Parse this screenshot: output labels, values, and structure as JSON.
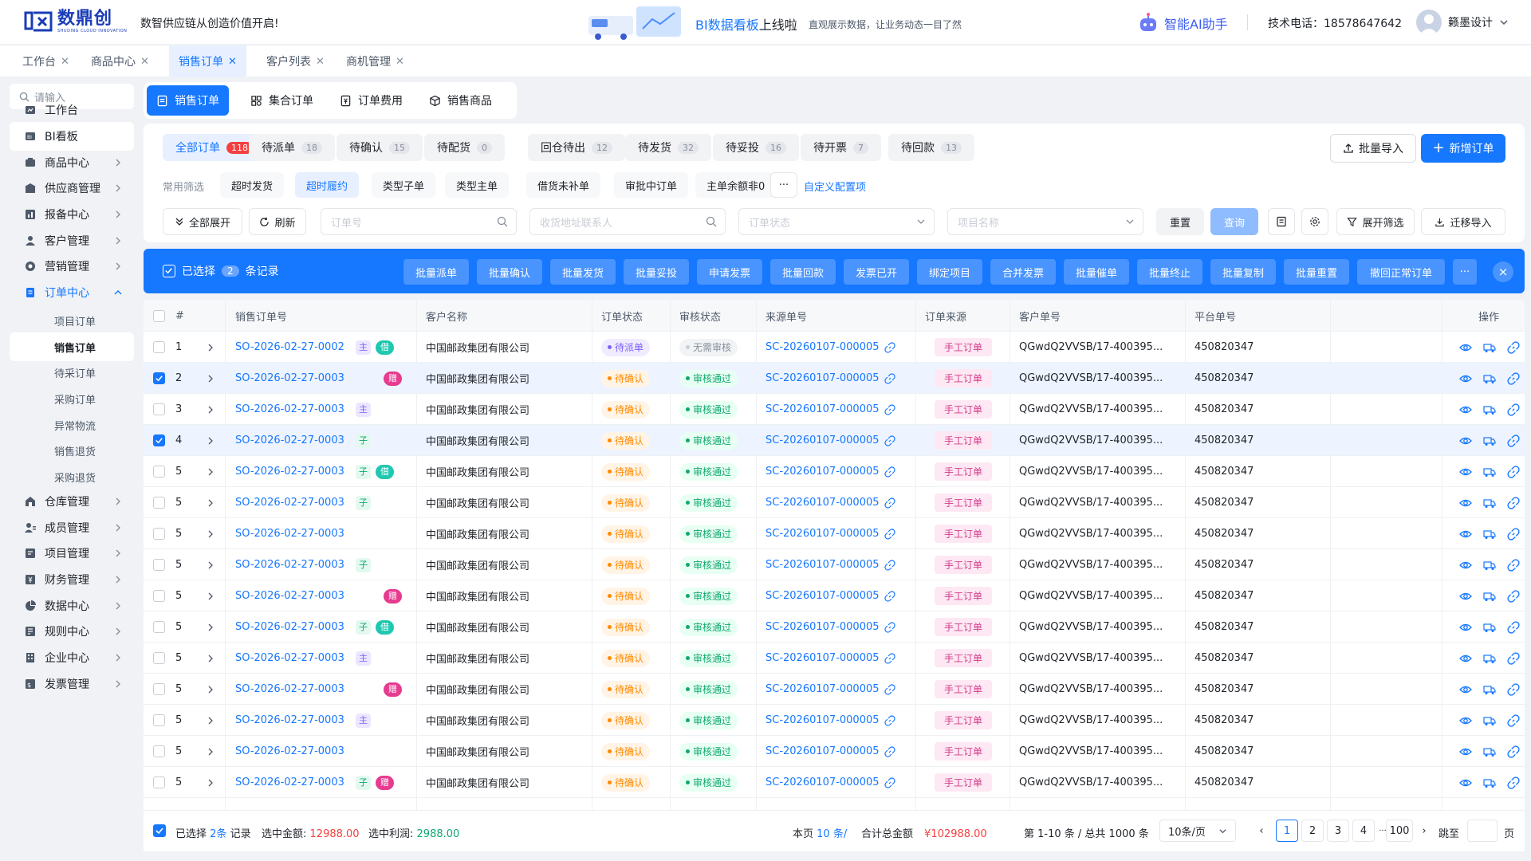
{
  "header": {
    "logo_text": "数鼎创",
    "logo_sub": "SHUDING CLOUD INNOVATION",
    "slogan": "数智供应链从创造价值开启!",
    "banner_title_a": "BI数据看板",
    "banner_title_b": "上线啦",
    "banner_desc": "直观展示数据，让业务动态一目了然",
    "ai_assistant": "智能AI助手",
    "phone": "技术电话：18578647642",
    "user_name": "籁墨设计"
  },
  "tabs": [
    {
      "label": "工作台"
    },
    {
      "label": "商品中心"
    },
    {
      "label": "销售订单"
    },
    {
      "label": "客户列表"
    },
    {
      "label": "商机管理"
    }
  ],
  "sidebar": {
    "search_placeholder": "请输入",
    "items": [
      {
        "label": "工作台",
        "icon": "workbench-icon"
      },
      {
        "label": "BI看板",
        "icon": "bi-board-icon"
      },
      {
        "label": "商品中心",
        "icon": "goods-icon"
      },
      {
        "label": "供应商管理",
        "icon": "supplier-icon"
      },
      {
        "label": "报备中心",
        "icon": "report-icon"
      },
      {
        "label": "客户管理",
        "icon": "customer-icon"
      },
      {
        "label": "营销管理",
        "icon": "marketing-icon"
      },
      {
        "label": "订单中心",
        "icon": "order-icon"
      },
      {
        "label": "仓库管理",
        "icon": "warehouse-icon"
      },
      {
        "label": "成员管理",
        "icon": "member-icon"
      },
      {
        "label": "项目管理",
        "icon": "project-icon"
      },
      {
        "label": "财务管理",
        "icon": "finance-icon"
      },
      {
        "label": "数据中心",
        "icon": "data-icon"
      },
      {
        "label": "规则中心",
        "icon": "rule-icon"
      },
      {
        "label": "企业中心",
        "icon": "enterprise-icon"
      },
      {
        "label": "发票管理",
        "icon": "invoice-icon"
      }
    ],
    "sub_items": [
      {
        "label": "项目订单"
      },
      {
        "label": "销售订单"
      },
      {
        "label": "待采订单"
      },
      {
        "label": "采购订单"
      },
      {
        "label": "异常物流"
      },
      {
        "label": "销售退货"
      },
      {
        "label": "采购退货"
      }
    ]
  },
  "order_types": [
    {
      "label": "销售订单",
      "icon": "sales-order-icon"
    },
    {
      "label": "集合订单",
      "icon": "grid-icon"
    },
    {
      "label": "订单费用",
      "icon": "fee-icon"
    },
    {
      "label": "销售商品",
      "icon": "box-icon"
    }
  ],
  "status_tabs": [
    {
      "label": "全部订单",
      "count": "118"
    },
    {
      "label": "待派单",
      "count": "18"
    },
    {
      "label": "待确认",
      "count": "15"
    },
    {
      "label": "待配货",
      "count": "0"
    },
    {
      "label": "回仓待出",
      "count": "12"
    },
    {
      "label": "待发货",
      "count": "32"
    },
    {
      "label": "待妥投",
      "count": "16"
    },
    {
      "label": "待开票",
      "count": "7"
    },
    {
      "label": "待回款",
      "count": "13"
    }
  ],
  "actions": {
    "import": "批量导入",
    "new_order": "新增订单"
  },
  "quick_filters": {
    "label": "常用筛选",
    "items": [
      "超时发货",
      "超时履约",
      "类型子单",
      "类型主单",
      "借货未补单",
      "审批中订单",
      "主单余额非0"
    ],
    "more": "···",
    "custom": "自定义配置项"
  },
  "search_bar": {
    "expand_all": "全部展开",
    "refresh": "刷新",
    "order_no_placeholder": "订单号",
    "address_placeholder": "收货地址联系人",
    "status_placeholder": "订单状态",
    "project_placeholder": "项目名称",
    "reset": "重置",
    "query": "查询",
    "expand_filter": "展开筛选",
    "migrate_import": "迁移导入"
  },
  "batch": {
    "selected_prefix": "已选择",
    "selected_count": "2",
    "selected_suffix": "条记录",
    "buttons": [
      "批量派单",
      "批量确认",
      "批量发货",
      "批量妥投",
      "申请发票",
      "批量回款",
      "发票已开",
      "绑定项目",
      "合并发票",
      "批量催单",
      "批量终止",
      "批量复制",
      "批量重置",
      "撤回正常订单"
    ],
    "more": "···",
    "close": "×"
  },
  "table": {
    "headers": [
      "#",
      "销售订单号",
      "客户名称",
      "订单状态",
      "审核状态",
      "来源单号",
      "订单来源",
      "客户单号",
      "平台单号",
      "操作"
    ],
    "rows": [
      {
        "idx": "1",
        "checked": false,
        "order": "SO-2026-02-27-0002",
        "tags": [
          "主",
          "借"
        ],
        "customer": "中国邮政集团有限公司",
        "status": "待派单",
        "status_type": "blue",
        "audit": "无需审核",
        "audit_type": "gray",
        "source_no": "SC-20260107-000005",
        "source": "手工订单",
        "cust_no": "QGwdQ2VVSB/17-400395...",
        "platform_no": "450820347"
      },
      {
        "idx": "2",
        "checked": true,
        "order": "SO-2026-02-27-0003",
        "tags": [
          "赠"
        ],
        "customer": "中国邮政集团有限公司",
        "status": "待确认",
        "status_type": "orange",
        "audit": "审核通过",
        "audit_type": "green",
        "source_no": "SC-20260107-000005",
        "source": "手工订单",
        "cust_no": "QGwdQ2VVSB/17-400395...",
        "platform_no": "450820347"
      },
      {
        "idx": "3",
        "checked": false,
        "order": "SO-2026-02-27-0003",
        "tags": [
          "主"
        ],
        "customer": "中国邮政集团有限公司",
        "status": "待确认",
        "status_type": "orange",
        "audit": "审核通过",
        "audit_type": "green",
        "source_no": "SC-20260107-000005",
        "source": "手工订单",
        "cust_no": "QGwdQ2VVSB/17-400395...",
        "platform_no": "450820347"
      },
      {
        "idx": "4",
        "checked": true,
        "order": "SO-2026-02-27-0003",
        "tags": [
          "子"
        ],
        "customer": "中国邮政集团有限公司",
        "status": "待确认",
        "status_type": "orange",
        "audit": "审核通过",
        "audit_type": "green",
        "source_no": "SC-20260107-000005",
        "source": "手工订单",
        "cust_no": "QGwdQ2VVSB/17-400395...",
        "platform_no": "450820347"
      },
      {
        "idx": "5",
        "checked": false,
        "order": "SO-2026-02-27-0003",
        "tags": [
          "子",
          "借"
        ],
        "customer": "中国邮政集团有限公司",
        "status": "待确认",
        "status_type": "orange",
        "audit": "审核通过",
        "audit_type": "green",
        "source_no": "SC-20260107-000005",
        "source": "手工订单",
        "cust_no": "QGwdQ2VVSB/17-400395...",
        "platform_no": "450820347"
      },
      {
        "idx": "5",
        "checked": false,
        "order": "SO-2026-02-27-0003",
        "tags": [
          "子"
        ],
        "customer": "中国邮政集团有限公司",
        "status": "待确认",
        "status_type": "orange",
        "audit": "审核通过",
        "audit_type": "green",
        "source_no": "SC-20260107-000005",
        "source": "手工订单",
        "cust_no": "QGwdQ2VVSB/17-400395...",
        "platform_no": "450820347"
      },
      {
        "idx": "5",
        "checked": false,
        "order": "SO-2026-02-27-0003",
        "tags": [],
        "customer": "中国邮政集团有限公司",
        "status": "待确认",
        "status_type": "orange",
        "audit": "审核通过",
        "audit_type": "green",
        "source_no": "SC-20260107-000005",
        "source": "手工订单",
        "cust_no": "QGwdQ2VVSB/17-400395...",
        "platform_no": "450820347"
      },
      {
        "idx": "5",
        "checked": false,
        "order": "SO-2026-02-27-0003",
        "tags": [
          "子"
        ],
        "customer": "中国邮政集团有限公司",
        "status": "待确认",
        "status_type": "orange",
        "audit": "审核通过",
        "audit_type": "green",
        "source_no": "SC-20260107-000005",
        "source": "手工订单",
        "cust_no": "QGwdQ2VVSB/17-400395...",
        "platform_no": "450820347"
      },
      {
        "idx": "5",
        "checked": false,
        "order": "SO-2026-02-27-0003",
        "tags": [
          "赠"
        ],
        "customer": "中国邮政集团有限公司",
        "status": "待确认",
        "status_type": "orange",
        "audit": "审核通过",
        "audit_type": "green",
        "source_no": "SC-20260107-000005",
        "source": "手工订单",
        "cust_no": "QGwdQ2VVSB/17-400395...",
        "platform_no": "450820347"
      },
      {
        "idx": "5",
        "checked": false,
        "order": "SO-2026-02-27-0003",
        "tags": [
          "子",
          "借"
        ],
        "customer": "中国邮政集团有限公司",
        "status": "待确认",
        "status_type": "orange",
        "audit": "审核通过",
        "audit_type": "green",
        "source_no": "SC-20260107-000005",
        "source": "手工订单",
        "cust_no": "QGwdQ2VVSB/17-400395...",
        "platform_no": "450820347"
      },
      {
        "idx": "5",
        "checked": false,
        "order": "SO-2026-02-27-0003",
        "tags": [
          "主"
        ],
        "customer": "中国邮政集团有限公司",
        "status": "待确认",
        "status_type": "orange",
        "audit": "审核通过",
        "audit_type": "green",
        "source_no": "SC-20260107-000005",
        "source": "手工订单",
        "cust_no": "QGwdQ2VVSB/17-400395...",
        "platform_no": "450820347"
      },
      {
        "idx": "5",
        "checked": false,
        "order": "SO-2026-02-27-0003",
        "tags": [
          "赠"
        ],
        "customer": "中国邮政集团有限公司",
        "status": "待确认",
        "status_type": "orange",
        "audit": "审核通过",
        "audit_type": "green",
        "source_no": "SC-20260107-000005",
        "source": "手工订单",
        "cust_no": "QGwdQ2VVSB/17-400395...",
        "platform_no": "450820347"
      },
      {
        "idx": "5",
        "checked": false,
        "order": "SO-2026-02-27-0003",
        "tags": [
          "主"
        ],
        "customer": "中国邮政集团有限公司",
        "status": "待确认",
        "status_type": "orange",
        "audit": "审核通过",
        "audit_type": "green",
        "source_no": "SC-20260107-000005",
        "source": "手工订单",
        "cust_no": "QGwdQ2VVSB/17-400395...",
        "platform_no": "450820347"
      },
      {
        "idx": "5",
        "checked": false,
        "order": "SO-2026-02-27-0003",
        "tags": [],
        "customer": "中国邮政集团有限公司",
        "status": "待确认",
        "status_type": "orange",
        "audit": "审核通过",
        "audit_type": "green",
        "source_no": "SC-20260107-000005",
        "source": "手工订单",
        "cust_no": "QGwdQ2VVSB/17-400395...",
        "platform_no": "450820347"
      },
      {
        "idx": "5",
        "checked": false,
        "order": "SO-2026-02-27-0003",
        "tags": [
          "子",
          "赠"
        ],
        "customer": "中国邮政集团有限公司",
        "status": "待确认",
        "status_type": "orange",
        "audit": "审核通过",
        "audit_type": "green",
        "source_no": "SC-20260107-000005",
        "source": "手工订单",
        "cust_no": "QGwdQ2VVSB/17-400395...",
        "platform_no": "450820347"
      }
    ]
  },
  "footer": {
    "selected": "已选择",
    "selected_count": "2条",
    "record": "记录",
    "amount_label": "选中金额:",
    "amount": "12988.00",
    "profit_label": "选中利润:",
    "profit": "2988.00",
    "page_label": "本页",
    "page_count": "10 条/",
    "total_label": "合计总金额",
    "total": "¥102988.00",
    "range": "第 1-10 条 / 总共 1000 条",
    "page_size": "10条/页",
    "pages": [
      "1",
      "2",
      "3",
      "4",
      "···",
      "100"
    ],
    "prev": "‹",
    "next": "›",
    "jump_label": "跳至",
    "jump_suffix": "页"
  },
  "colors": {
    "primary": "#1677ff",
    "danger": "#f53f3f",
    "success": "#0fa86f",
    "warning": "#ff8a00"
  }
}
